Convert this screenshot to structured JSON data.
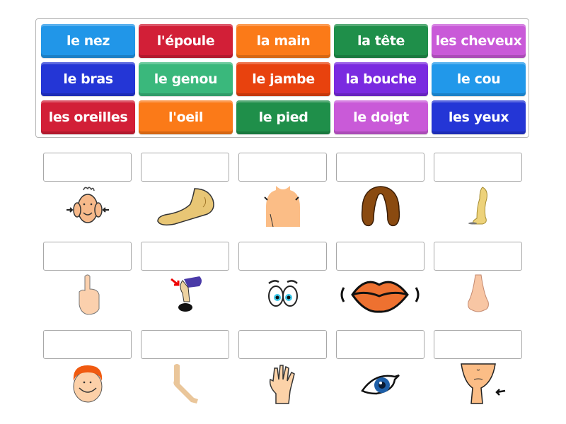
{
  "word_bank": {
    "tiles": [
      {
        "label": "le nez",
        "color": "#2196e8"
      },
      {
        "label": "l'époule",
        "color": "#d21f37"
      },
      {
        "label": "la main",
        "color": "#fb7a18"
      },
      {
        "label": "la tête",
        "color": "#1f8f4a"
      },
      {
        "label": "les cheveux",
        "color": "#c95ad8"
      },
      {
        "label": "le bras",
        "color": "#2436d6"
      },
      {
        "label": "le genou",
        "color": "#3ab87c"
      },
      {
        "label": "le jambe",
        "color": "#e8420e"
      },
      {
        "label": "la bouche",
        "color": "#7a2be0"
      },
      {
        "label": "le cou",
        "color": "#2198ea"
      },
      {
        "label": "les oreilles",
        "color": "#d21f37"
      },
      {
        "label": "l'oeil",
        "color": "#fb7a18"
      },
      {
        "label": "le pied",
        "color": "#1f8f4a"
      },
      {
        "label": "le doigt",
        "color": "#c95ad8"
      },
      {
        "label": "les yeux",
        "color": "#2436d6"
      }
    ]
  },
  "targets": [
    {
      "picture": "ears",
      "answer": ""
    },
    {
      "picture": "foot",
      "answer": ""
    },
    {
      "picture": "shoulder",
      "answer": ""
    },
    {
      "picture": "hair",
      "answer": ""
    },
    {
      "picture": "leg",
      "answer": ""
    },
    {
      "picture": "finger",
      "answer": ""
    },
    {
      "picture": "knee",
      "answer": ""
    },
    {
      "picture": "eyes",
      "answer": ""
    },
    {
      "picture": "mouth",
      "answer": ""
    },
    {
      "picture": "nose",
      "answer": ""
    },
    {
      "picture": "head",
      "answer": ""
    },
    {
      "picture": "arm",
      "answer": ""
    },
    {
      "picture": "hand",
      "answer": ""
    },
    {
      "picture": "eye",
      "answer": ""
    },
    {
      "picture": "neck",
      "answer": ""
    }
  ]
}
